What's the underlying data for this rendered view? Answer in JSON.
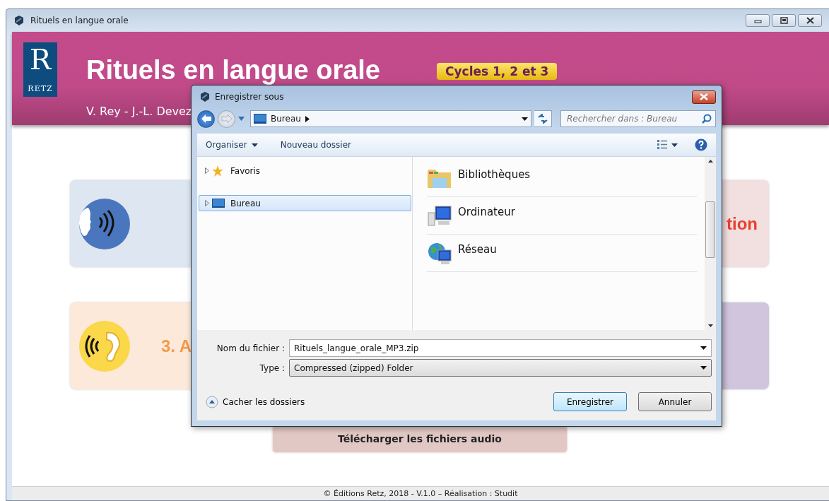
{
  "window": {
    "title": "Rituels en langue orale"
  },
  "header": {
    "logo_letter": "R",
    "logo_text": "RETZ",
    "title": "Rituels en langue orale",
    "badge": "Cycles 1, 2 et 3",
    "authors": "V. Rey -  J.-L. Devez"
  },
  "cards": [
    {
      "kind": "speech",
      "color": "#dde6f1"
    },
    {
      "kind": "text",
      "color": "#f2dfe0",
      "label": "tion"
    },
    {
      "kind": "ear",
      "color": "#fde9d9",
      "label": "3. A"
    },
    {
      "kind": "text",
      "color": "#d0c5dd"
    }
  ],
  "download_button": "Télécharger les fichiers audio",
  "footer": "© Éditions Retz, 2018 - V.1.0 – Réalisation : Studit",
  "dialog": {
    "title": "Enregistrer sous",
    "address": "Bureau",
    "search": {
      "placeholder": "Rechercher dans : Bureau"
    },
    "toolbar": [
      "Organiser",
      "Nouveau dossier"
    ],
    "nav": [
      {
        "label": "Favoris",
        "kind": "star",
        "selected": false
      },
      {
        "label": "Bureau",
        "kind": "desktop",
        "selected": true
      }
    ],
    "items": [
      {
        "label": "Bibliothèques",
        "kind": "library"
      },
      {
        "label": "Ordinateur",
        "kind": "computer"
      },
      {
        "label": "Réseau",
        "kind": "network"
      }
    ],
    "filename": {
      "label": "Nom du fichier :",
      "value": "Rituels_langue_orale_MP3.zip"
    },
    "type": {
      "label": "Type :",
      "value": "Compressed (zipped) Folder"
    },
    "toggle": "Cacher les dossiers",
    "buttons": [
      {
        "label": "Enregistrer",
        "kind": "primary"
      },
      {
        "label": "Annuler",
        "kind": "secondary"
      }
    ]
  }
}
